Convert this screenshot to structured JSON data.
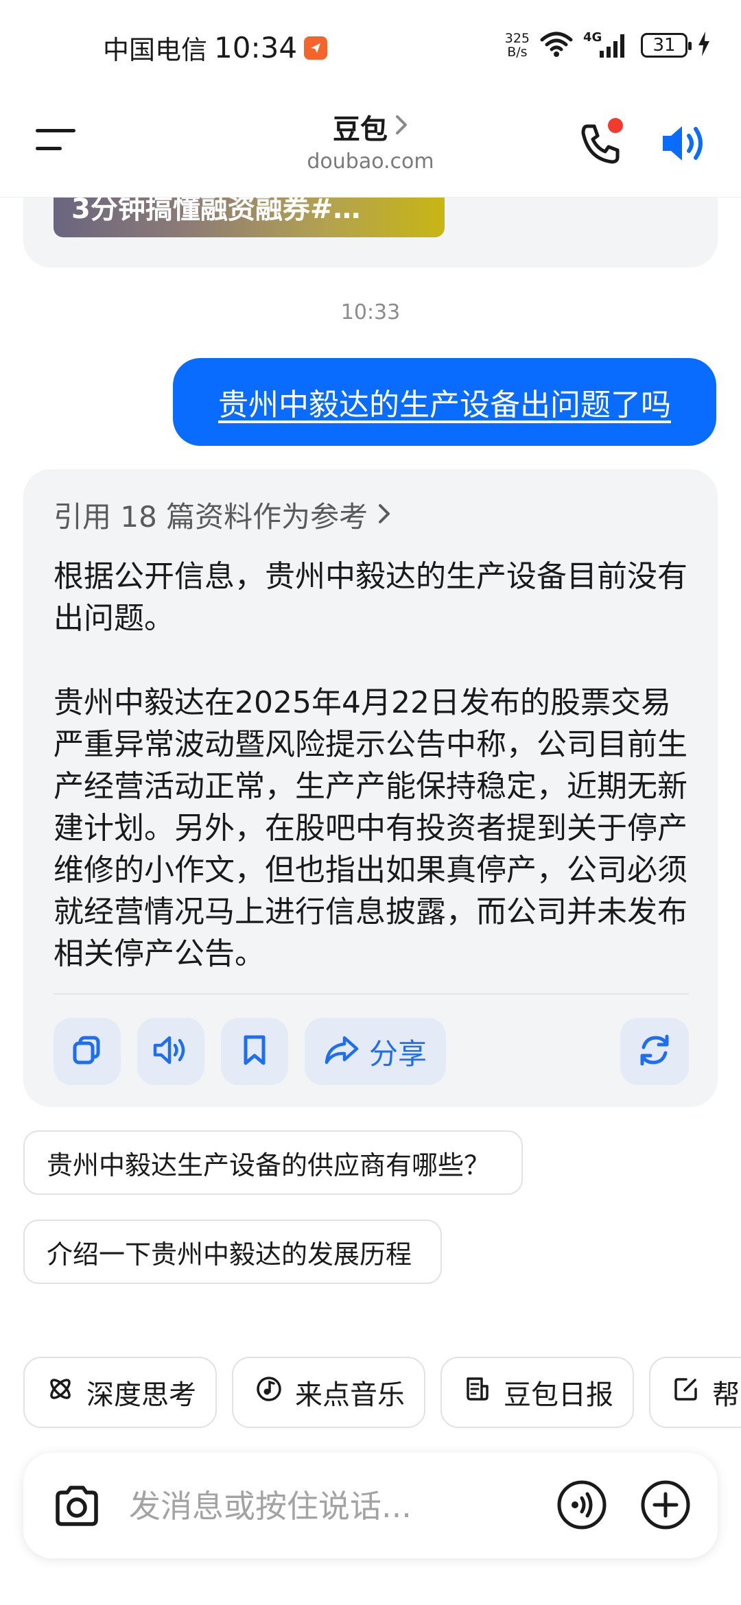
{
  "status_bar": {
    "carrier": "中国电信",
    "time": "10:34",
    "net_speed_value": "325",
    "net_speed_unit": "B/s",
    "network_type": "4G",
    "battery": "31"
  },
  "header": {
    "title": "豆包",
    "subtitle": "doubao.com",
    "call_badge_color": "#f23a2e"
  },
  "previous_message": {
    "thumbnail_caption": "3分钟搞懂融资融券#…"
  },
  "chat": {
    "timestamp": "10:33",
    "user_message": "贵州中毅达的生产设备出问题了吗",
    "ai_reply": {
      "reference_label": "引用 18 篇资料作为参考",
      "paragraph_1": "根据公开信息，贵州中毅达的生产设备目前没有出问题。",
      "paragraph_2": "贵州中毅达在2025年4月22日发布的股票交易严重异常波动暨风险提示公告中称，公司目前生产经营活动正常，生产产能保持稳定，近期无新建计划。另外，在股吧中有投资者提到关于停产维修的小作文，但也指出如果真停产，公司必须就经营情况马上进行信息披露，而公司并未发布相关停产公告。",
      "actions": {
        "copy_icon": "copy-icon",
        "read_aloud_icon": "speaker-icon",
        "bookmark_icon": "bookmark-icon",
        "share_label": "分享",
        "regenerate_icon": "refresh-icon"
      }
    },
    "suggestions": [
      "贵州中毅达生产设备的供应商有哪些？",
      "介绍一下贵州中毅达的发展历程"
    ]
  },
  "quick_chips": [
    {
      "label": "深度思考",
      "icon": "atom-icon"
    },
    {
      "label": "来点音乐",
      "icon": "music-note-icon"
    },
    {
      "label": "豆包日报",
      "icon": "newspaper-icon"
    },
    {
      "label": "帮",
      "icon": "edit-icon"
    }
  ],
  "composer": {
    "placeholder": "发消息或按住说话...",
    "camera_icon": "camera-icon",
    "voice_icon": "voice-call-icon",
    "plus_icon": "plus-icon"
  },
  "colors": {
    "accent_blue": "#0a6cff",
    "action_blue": "#1d6ff0",
    "card_gray": "#f3f4f6"
  }
}
